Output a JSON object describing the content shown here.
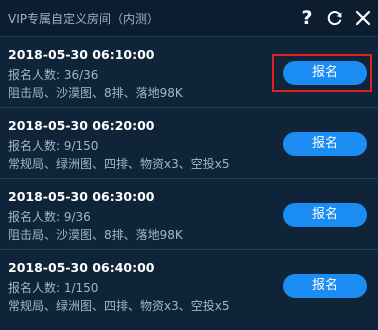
{
  "header": {
    "title": "VIP专属自定义房间（内测）",
    "icons": [
      "help-icon",
      "refresh-icon",
      "close-icon"
    ],
    "help_glyph": "?"
  },
  "rooms": [
    {
      "time": "2018-05-30 06:10:00",
      "count": "报名人数: 36/36",
      "mode": "阻击局、沙漠图、8排、落地98K",
      "button": "报名",
      "highlighted": true
    },
    {
      "time": "2018-05-30 06:20:00",
      "count": "报名人数: 9/150",
      "mode": "常规局、绿洲图、四排、物资x3、空投x5",
      "button": "报名",
      "highlighted": false
    },
    {
      "time": "2018-05-30 06:30:00",
      "count": "报名人数: 9/36",
      "mode": "阻击局、沙漠图、8排、落地98K",
      "button": "报名",
      "highlighted": false
    },
    {
      "time": "2018-05-30 06:40:00",
      "count": "报名人数: 1/150",
      "mode": "常规局、绿洲图、四排、物资x3、空投x5",
      "button": "报名",
      "highlighted": false
    }
  ],
  "colors": {
    "background": "#0f2438",
    "header_bg": "#0b1d2f",
    "button": "#1a8cf2",
    "highlight": "#e02020",
    "secondary_text": "#a3b6c9"
  }
}
